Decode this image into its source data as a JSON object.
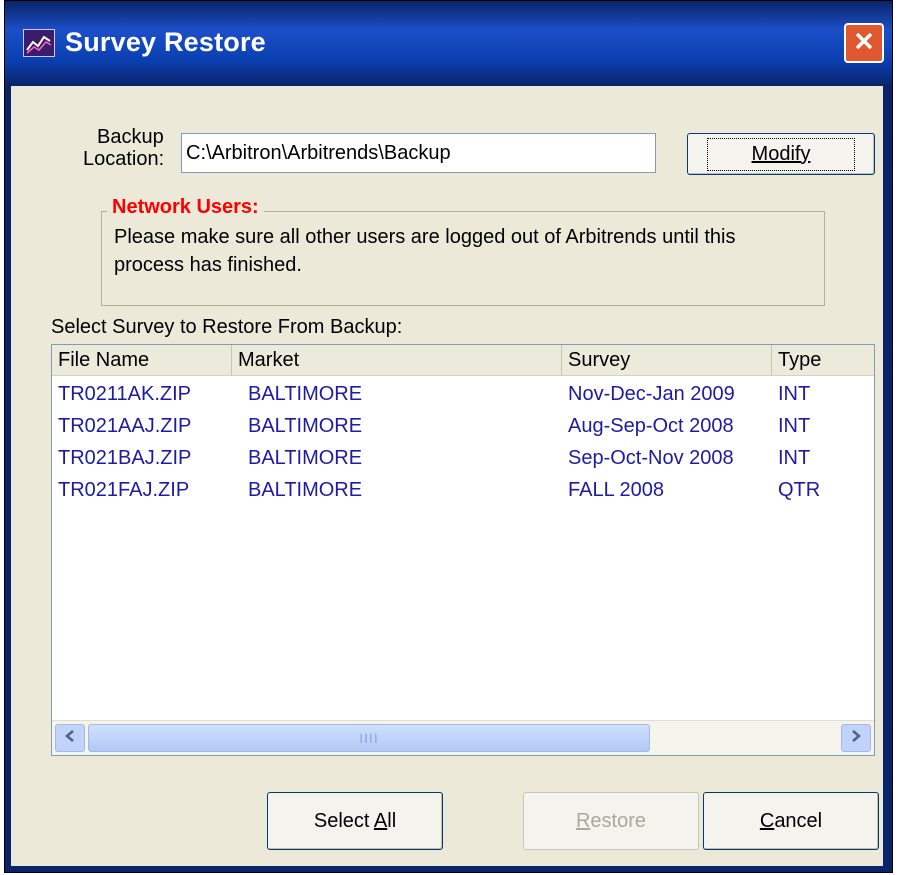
{
  "window": {
    "title": "Survey Restore",
    "icons": {
      "app": "chart-icon",
      "close": "close-icon"
    }
  },
  "backup": {
    "label_line1": "Backup",
    "label_line2": "Location:",
    "path": "C:\\Arbitron\\Arbitrends\\Backup",
    "modify_button": "Modify"
  },
  "notice": {
    "title": "Network Users:",
    "text": "Please make sure all other users are logged out of Arbitrends until this process has finished."
  },
  "list": {
    "label": "Select Survey to Restore From Backup:",
    "columns": [
      "File Name",
      "Market",
      "Survey",
      "Type"
    ],
    "rows": [
      [
        "TR0211AK.ZIP",
        "BALTIMORE",
        "Nov-Dec-Jan 2009",
        "INT"
      ],
      [
        "TR021AAJ.ZIP",
        "BALTIMORE",
        "Aug-Sep-Oct 2008",
        "INT"
      ],
      [
        "TR021BAJ.ZIP",
        "BALTIMORE",
        "Sep-Oct-Nov 2008",
        "INT"
      ],
      [
        "TR021FAJ.ZIP",
        "BALTIMORE",
        "FALL 2008",
        "QTR"
      ]
    ],
    "scrollbar_grip": "IIII"
  },
  "buttons": {
    "select_all": {
      "prefix": "Select ",
      "accel": "A",
      "suffix": "ll"
    },
    "restore": {
      "prefix": "",
      "accel": "R",
      "suffix": "estore",
      "enabled": false
    },
    "cancel": {
      "prefix": "",
      "accel": "C",
      "suffix": "ancel"
    }
  },
  "colors": {
    "title_bar": "#0a246a",
    "dialog_bg": "#ece9d8",
    "notice_title": "#ff0000",
    "list_text": "#1b1ba8",
    "close_button": "#e0582f"
  }
}
